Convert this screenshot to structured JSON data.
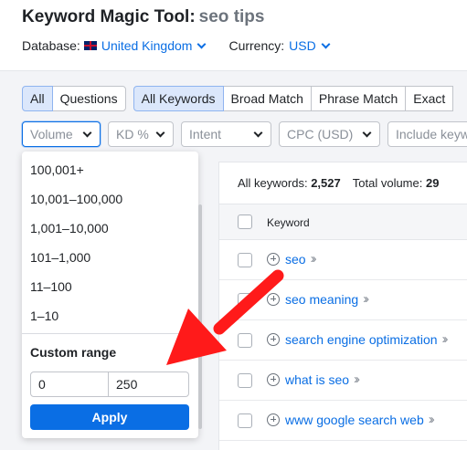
{
  "header": {
    "tool_name": "Keyword Magic Tool:",
    "query": "seo tips",
    "database_label": "Database:",
    "database_value": "United Kingdom",
    "currency_label": "Currency:",
    "currency_value": "USD"
  },
  "tabs_group1": [
    "All",
    "Questions"
  ],
  "tabs_group2": [
    "All Keywords",
    "Broad Match",
    "Phrase Match",
    "Exact"
  ],
  "filters": {
    "volume": "Volume",
    "kd": "KD %",
    "intent": "Intent",
    "cpc": "CPC (USD)",
    "include_placeholder": "Include keyw"
  },
  "volume_menu": {
    "options": [
      "100,001+",
      "10,001–100,000",
      "1,001–10,000",
      "101–1,000",
      "11–100",
      "1–10"
    ],
    "custom_range_label": "Custom range",
    "from_value": "0",
    "to_value": "250",
    "apply_label": "Apply"
  },
  "table": {
    "all_keywords_label": "All keywords:",
    "all_keywords_count": "2,527",
    "total_volume_label": "Total volume:",
    "total_volume_value": "29",
    "column_keyword": "Keyword",
    "rows": [
      "seo",
      "seo meaning",
      "search engine optimization",
      "what is seo",
      "www google search web"
    ]
  },
  "colors": {
    "accent": "#0a6ee4",
    "arrow": "#ff1a1a",
    "active_tab_bg": "#dbe7fb"
  }
}
